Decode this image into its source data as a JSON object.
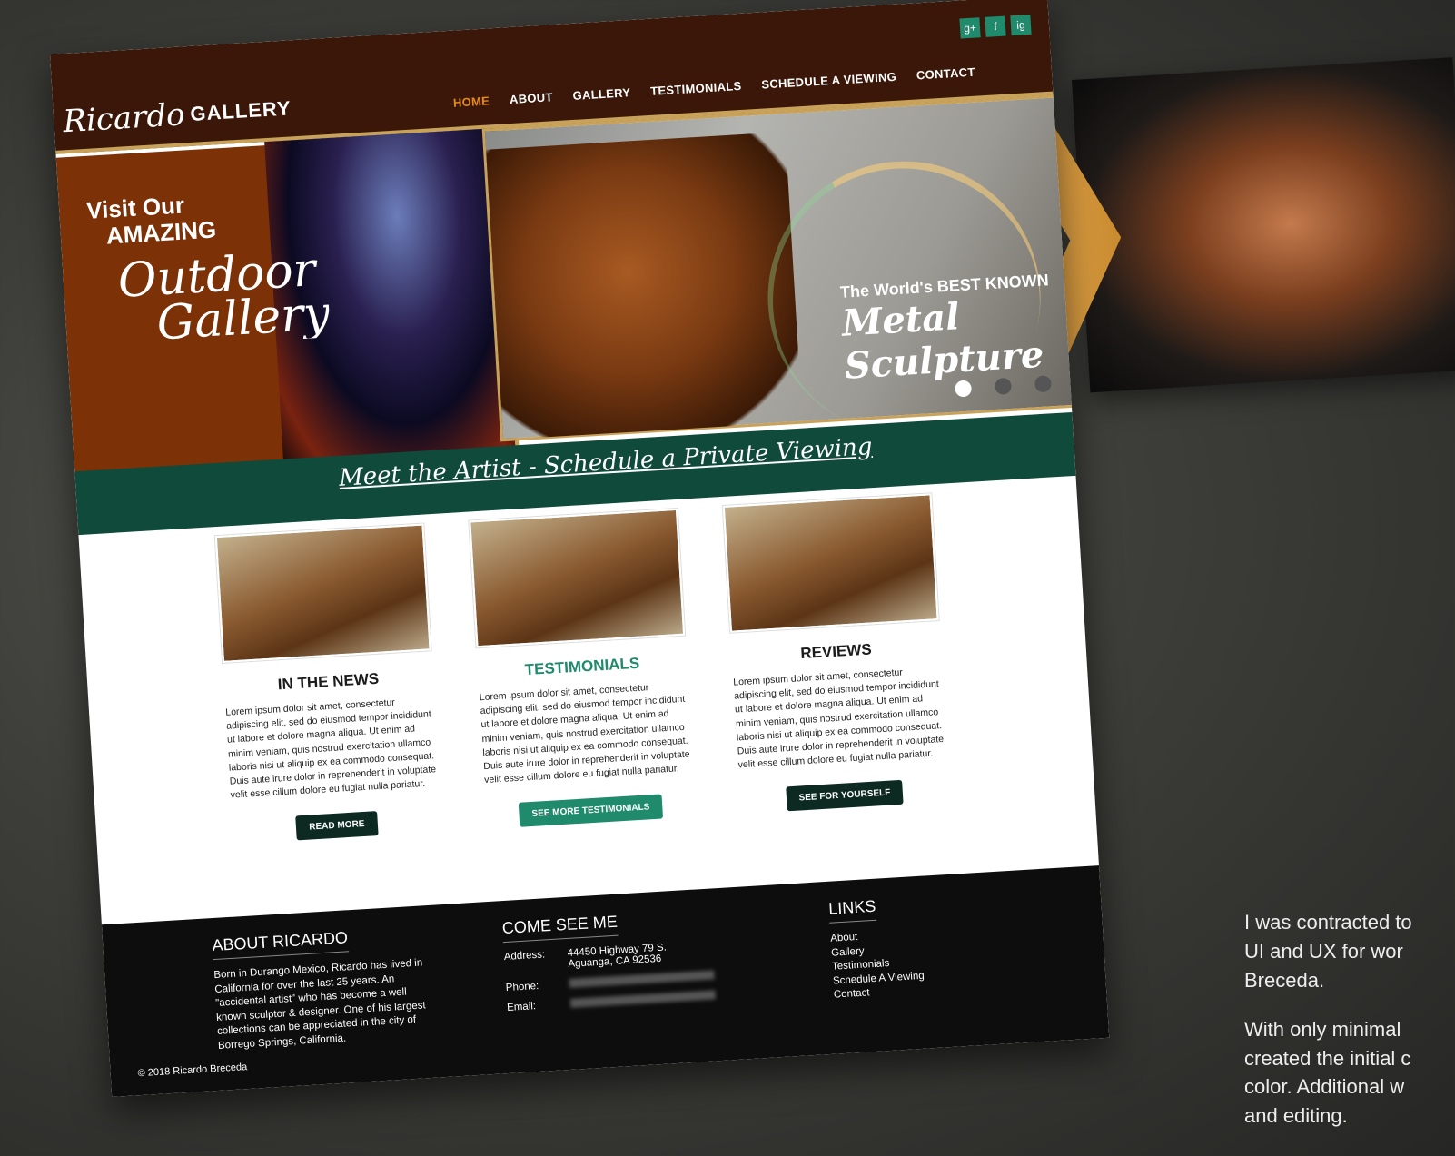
{
  "site": {
    "logo_script": "Ricardo",
    "logo_word": "GALLERY",
    "social": [
      "g+",
      "f",
      "ig"
    ],
    "menu": [
      "HOME",
      "ABOUT",
      "GALLERY",
      "TESTIMONIALS",
      "SCHEDULE A VIEWING",
      "CONTACT"
    ],
    "active_menu": "HOME"
  },
  "hero": {
    "visit_line1": "Visit Our",
    "visit_line2": "AMAZING",
    "outdoor": "Outdoor",
    "gallery": "Gallery",
    "tag1": "The World's BEST KNOWN",
    "tag2": "Metal Sculpture",
    "meet": "Meet the Artist - Schedule a Private Viewing"
  },
  "columns": [
    {
      "title": "IN THE NEWS",
      "body": "Lorem ipsum dolor sit amet, consectetur adipiscing elit, sed do eiusmod tempor incididunt ut labore et dolore magna aliqua. Ut enim ad minim veniam, quis nostrud exercitation ullamco laboris nisi ut aliquip ex ea commodo consequat. Duis aute irure dolor in reprehenderit in voluptate velit esse cillum dolore eu fugiat nulla pariatur.",
      "button": "READ MORE"
    },
    {
      "title": "TESTIMONIALS",
      "body": "Lorem ipsum dolor sit amet, consectetur adipiscing elit, sed do eiusmod tempor incididunt ut labore et dolore magna aliqua. Ut enim ad minim veniam, quis nostrud exercitation ullamco laboris nisi ut aliquip ex ea commodo consequat. Duis aute irure dolor in reprehenderit in voluptate velit esse cillum dolore eu fugiat nulla pariatur.",
      "button": "SEE MORE TESTIMONIALS"
    },
    {
      "title": "REVIEWS",
      "body": "Lorem ipsum dolor sit amet, consectetur adipiscing elit, sed do eiusmod tempor incididunt ut labore et dolore magna aliqua. Ut enim ad minim veniam, quis nostrud exercitation ullamco laboris nisi ut aliquip ex ea commodo consequat. Duis aute irure dolor in reprehenderit in voluptate velit esse cillum dolore eu fugiat nulla pariatur.",
      "button": "SEE FOR YOURSELF"
    }
  ],
  "footer": {
    "about_title": "ABOUT RICARDO",
    "about_body": "Born in Durango Mexico, Ricardo has lived in California for over the last 25 years. An \"accidental artist\" who has become a well known sculptor & designer. One of his largest collections can be appreciated in the city of Borrego Springs, California.",
    "contact_title": "COME SEE ME",
    "address_label": "Address:",
    "address_line1": "44450 Highway 79 S.",
    "address_line2": "Aguanga, CA 92536",
    "phone_label": "Phone:",
    "email_label": "Email:",
    "links_title": "LINKS",
    "links": [
      "About",
      "Gallery",
      "Testimonials",
      "Schedule A Viewing",
      "Contact"
    ],
    "copyright": "© 2018  Ricardo Breceda"
  },
  "caption": {
    "line1": "I was contracted to",
    "line2": "UI and UX for wor",
    "line3": "Breceda.",
    "line4": "With only minimal",
    "line5": "created the initial c",
    "line6": "color. Additional w",
    "line7": "and editing."
  },
  "colors": {
    "brown": "#3a1708",
    "green": "#1f8a6c",
    "gold": "#c9a25a",
    "orange": "#e58b1c"
  }
}
